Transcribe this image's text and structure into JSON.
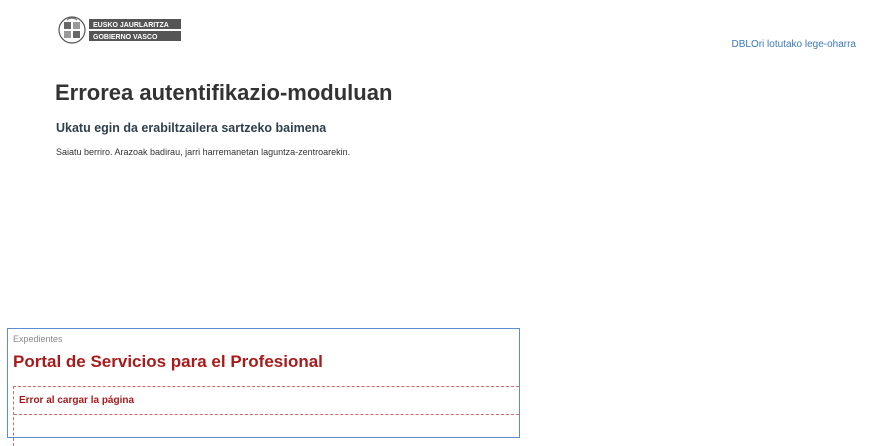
{
  "header": {
    "logo": {
      "line1": "EUSKO JAURLARITZA",
      "line2": "GOBIERNO VASCO",
      "icon": "basque-government-emblem-icon"
    },
    "legal_link": "DBLOri lotutako lege-oharra"
  },
  "main": {
    "title": "Errorea autentifikazio-moduluan",
    "subtitle": "Ukatu egin da erabiltzailera sartzeko baimena",
    "message": "Saiatu berriro. Arazoak badirau, jarri harremanetan laguntza-zentroarekin."
  },
  "portal_panel": {
    "breadcrumb": "Expedientes",
    "title": "Portal de Servicios para el Profesional",
    "error": "Error al cargar la página"
  },
  "colors": {
    "link": "#3a78b9",
    "portal_title": "#a61b1b",
    "panel_border": "#5b8ed0"
  }
}
